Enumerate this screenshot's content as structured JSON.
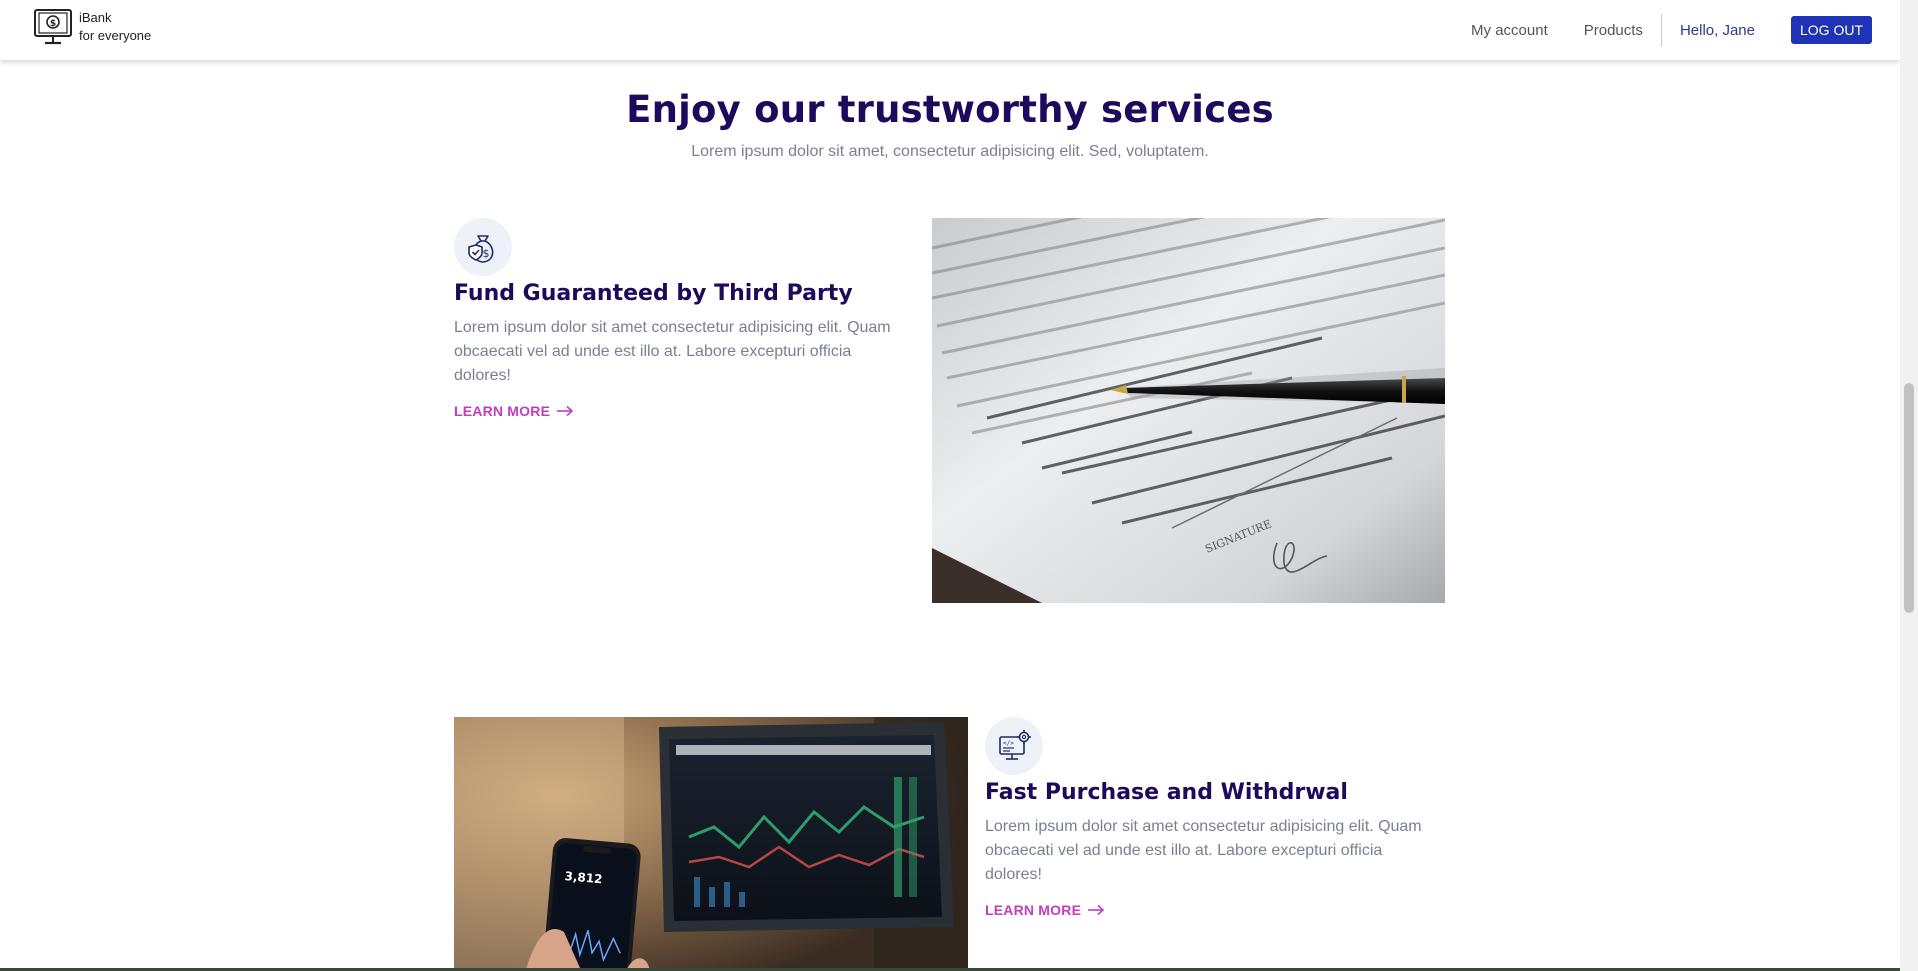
{
  "navbar": {
    "brand_line1": "iBank",
    "brand_line2": "for everyone",
    "links": [
      "My account",
      "Products"
    ],
    "greeting": "Hello, Jane",
    "logout_label": "LOG OUT",
    "logo_icon": "monitor-dollar-icon"
  },
  "section": {
    "title": "Enjoy our trustworthy services",
    "subtitle": "Lorem ipsum dolor sit amet, consectetur adipisicing elit. Sed, voluptatem."
  },
  "features": [
    {
      "icon": "money-bag-shield-icon",
      "title": "Fund Guaranteed by Third Party",
      "text": "Lorem ipsum dolor sit amet consectetur adipisicing elit. Quam obcaecati vel ad unde est illo at. Labore excepturi officia dolores!",
      "link_label": "LEARN MORE"
    },
    {
      "icon": "computer-gear-icon",
      "title": "Fast Purchase and Withdrwal",
      "text": "Lorem ipsum dolor sit amet consectetur adipisicing elit. Quam obcaecati vel ad unde est illo at. Labore excepturi officia dolores!",
      "link_label": "LEARN MORE"
    }
  ],
  "colors": {
    "heading": "#1e0a5c",
    "body_text": "#7a7f93",
    "accent_link": "#c03dbd",
    "logout_button": "#1e33b8",
    "greeting": "#2d3a8c"
  }
}
